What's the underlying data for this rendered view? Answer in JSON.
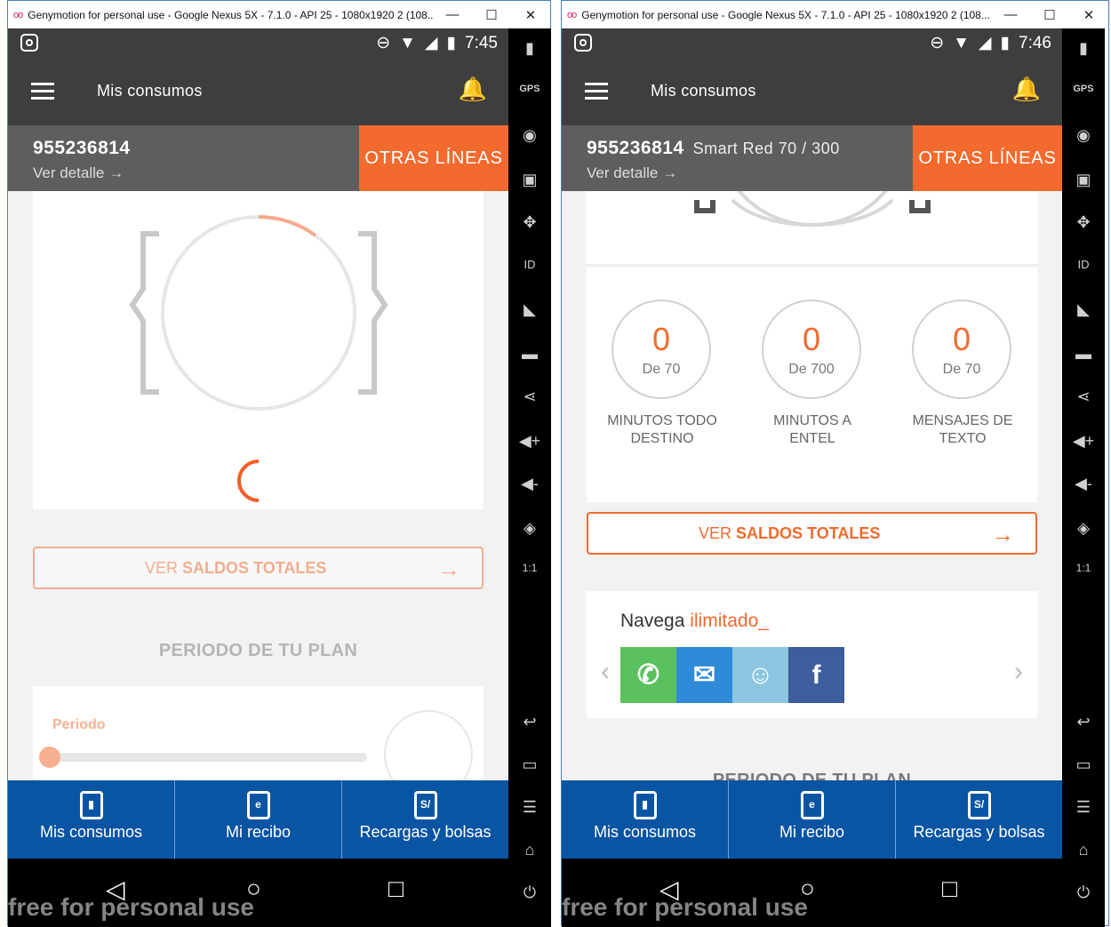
{
  "windows": [
    {
      "title": "Genymotion for personal use - Google Nexus 5X - 7.1.0 - API 25 - 1080x1920 2 (108...",
      "time": "7:45"
    },
    {
      "title": "Genymotion for personal use - Google Nexus 5X - 7.1.0 - API 25 - 1080x1920 2 (108...",
      "time": "7:46"
    }
  ],
  "window_buttons": {
    "minimize": "—",
    "maximize": "☐",
    "close": "✕"
  },
  "app": {
    "screen_title": "Mis consumos",
    "phone_number": "955236814",
    "plan_name": "Smart Red 70 / 300",
    "detail_link": "Ver detalle",
    "other_lines": "OTRAS LÍNEAS",
    "saldos_button_prefix": "VER ",
    "saldos_button_bold": "SALDOS TOTALES",
    "period_title": "PERIODO DE TU PLAN",
    "period_label": "Periodo",
    "period_progress": 0
  },
  "balances": [
    {
      "value": "0",
      "of": "De 70",
      "label_line1": "MINUTOS TODO",
      "label_line2": "DESTINO"
    },
    {
      "value": "0",
      "of": "De 700",
      "label_line1": "MINUTOS A",
      "label_line2": "ENTEL"
    },
    {
      "value": "0",
      "of": "De 70",
      "label_line1": "MENSAJES DE",
      "label_line2": "TEXTO"
    }
  ],
  "promo": {
    "title_part1": "Navega ",
    "title_part2": "ilimitado_",
    "apps": [
      {
        "name": "whatsapp-icon",
        "color": "#5bc15e"
      },
      {
        "name": "messenger-icon",
        "color": "#2f8ad8"
      },
      {
        "name": "waze-icon",
        "color": "#8cc6e0"
      },
      {
        "name": "facebook-icon",
        "color": "#3d5d9c"
      }
    ]
  },
  "bottom_nav": [
    {
      "label": "Mis consumos",
      "icon": "phone-chart-icon"
    },
    {
      "label": "Mi recibo",
      "icon": "receipt-icon"
    },
    {
      "label": "Recargas y bolsas",
      "icon": "recharge-bag-icon"
    }
  ],
  "watermark": "free for personal use",
  "colors": {
    "accent": "#f26a2e",
    "nav": "#0a55a3",
    "header": "#3e3e3e",
    "linebar": "#5e5e60"
  }
}
